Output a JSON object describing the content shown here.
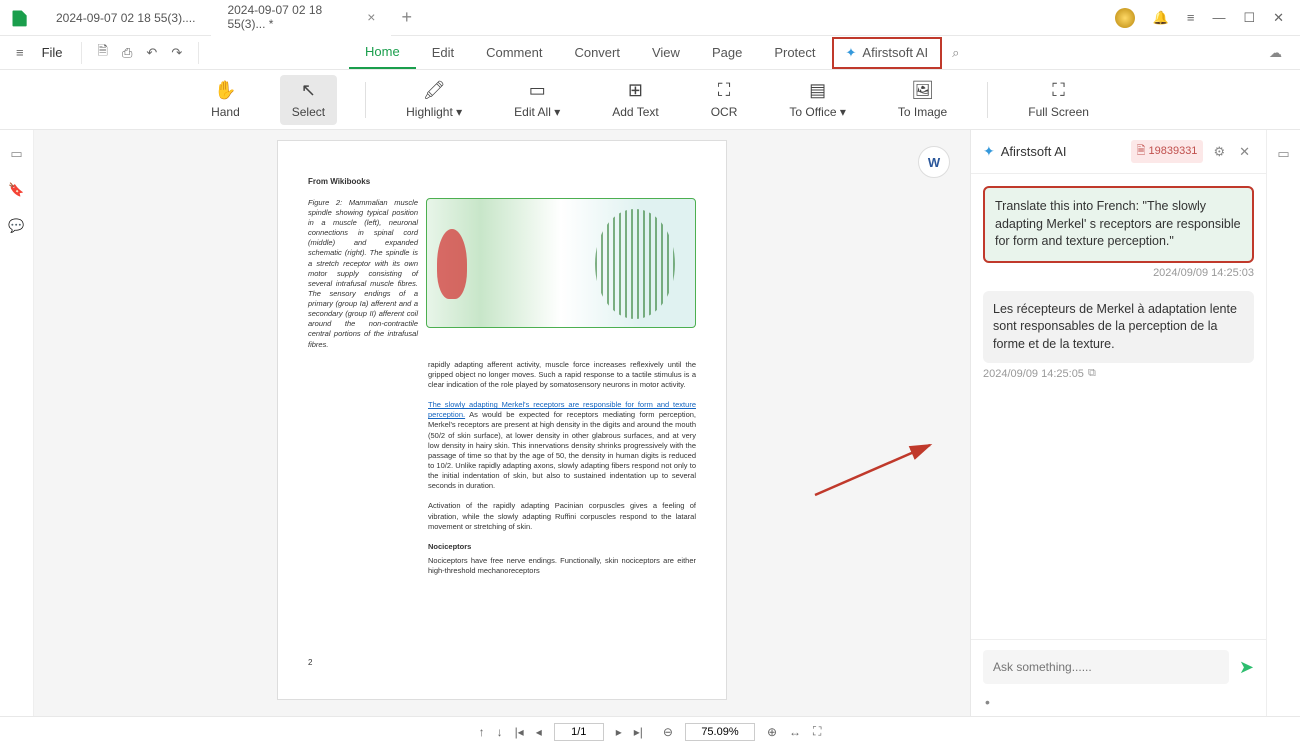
{
  "tabs": [
    {
      "label": "2024-09-07 02 18 55(3)...."
    },
    {
      "label": "2024-09-07 02 18 55(3)... *"
    }
  ],
  "file_label": "File",
  "menu": {
    "home": "Home",
    "edit": "Edit",
    "comment": "Comment",
    "convert": "Convert",
    "view": "View",
    "page": "Page",
    "protect": "Protect",
    "ai": "Afirstsoft AI"
  },
  "toolbar": {
    "hand": "Hand",
    "select": "Select",
    "highlight": "Highlight",
    "edit_all": "Edit All",
    "add_text": "Add Text",
    "ocr": "OCR",
    "to_office": "To Office",
    "to_image": "To Image",
    "full_screen": "Full Screen"
  },
  "document": {
    "heading": "From Wikibooks",
    "figure_caption": "Figure 2: Mammalian muscle spindle showing typical position in a muscle (left), neuronal connections in spinal cord (middle) and expanded schematic (right). The spindle is a stretch receptor with its own motor supply consisting of several intrafusal muscle fibres. The sensory endings of a primary (group Ia) afferent and a secondary (group II) afferent coil around the non-contractile central portions of the intrafusal fibres.",
    "para1": "rapidly adapting afferent activity, muscle force increases reflexively until the gripped object no longer moves. Such a rapid response to a tactile stimulus is a clear indication of the role played by somatosensory neurons in motor activity.",
    "highlighted": "The slowly adapting Merkel's receptors are responsible for form and texture perception.",
    "para2": " As would be expected for receptors mediating form perception, Merkel's receptors are present at high density in the digits and around the mouth (50/2 of skin surface), at lower density in other glabrous surfaces, and at very low density in hairy skin. This innervations density shrinks progressively with the passage of time so that by the age of 50, the density in human digits is reduced to 10/2. Unlike rapidly adapting axons, slowly adapting fibers respond not only to the initial indentation of skin, but also to sustained indentation up to several seconds in duration.",
    "para3": "Activation of the rapidly adapting Pacinian corpuscles gives a feeling of vibration, while the slowly adapting Ruffini corpuscles respond to the lataral movement or stretching of skin.",
    "sub1": "Nociceptors",
    "para4": "Nociceptors have free nerve endings. Functionally, skin nociceptors are either high-threshold mechanoreceptors",
    "page_number": "2"
  },
  "ai_panel": {
    "title": "Afirstsoft AI",
    "balance": "19839331",
    "user_msg": "Translate this into French: \"The slowly adapting Merkel' s receptors are responsible for form and texture perception.\"",
    "user_time": "2024/09/09 14:25:03",
    "assistant_msg": "Les récepteurs de Merkel à adaptation lente sont responsables de la perception de la forme et de la texture.",
    "assistant_time": "2024/09/09 14:25:05",
    "placeholder": "Ask something......"
  },
  "statusbar": {
    "page": "1/1",
    "zoom": "75.09%"
  }
}
